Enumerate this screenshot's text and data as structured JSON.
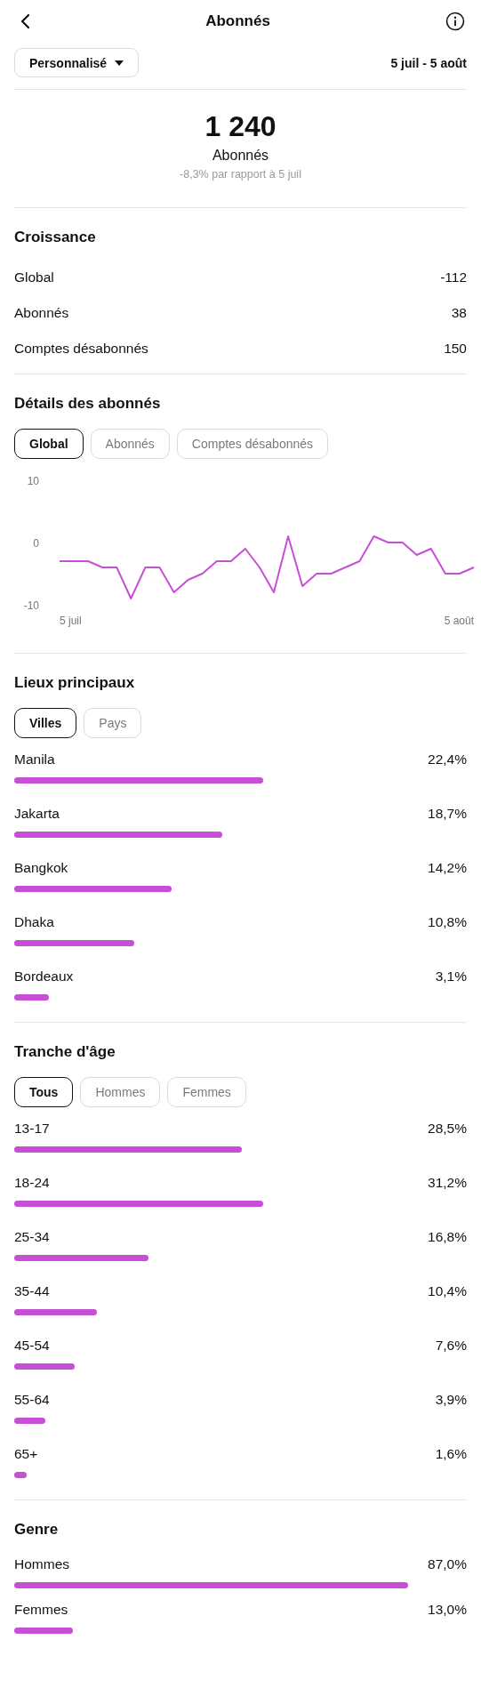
{
  "header": {
    "title": "Abonnés"
  },
  "filter": {
    "label": "Personnalisé",
    "date_range": "5 juil - 5 août"
  },
  "summary": {
    "value": "1 240",
    "label": "Abonnés",
    "comparison": "-8,3% par rapport à 5 juil"
  },
  "growth": {
    "title": "Croissance",
    "rows": [
      {
        "label": "Global",
        "value": "-112"
      },
      {
        "label": "Abonnés",
        "value": "38"
      },
      {
        "label": "Comptes désabonnés",
        "value": "150"
      }
    ]
  },
  "details": {
    "title": "Détails des abonnés",
    "tabs": [
      {
        "label": "Global",
        "selected": true
      },
      {
        "label": "Abonnés",
        "selected": false
      },
      {
        "label": "Comptes désabonnés",
        "selected": false
      }
    ],
    "axis_start_label": "5 juil",
    "axis_end_label": "5 août",
    "chart_data": {
      "type": "line",
      "ylim": [
        -10,
        10
      ],
      "yticks": [
        -10,
        0,
        10
      ],
      "series": [
        {
          "color": "#c74fd6",
          "values": [
            -3,
            -3,
            -3,
            -4,
            -4,
            -9,
            -4,
            -4,
            -8,
            -6,
            -5,
            -3,
            -3,
            -1,
            -4,
            -8,
            1,
            -7,
            -5,
            -5,
            -4,
            -3,
            1,
            0,
            0,
            -2,
            -1,
            -5,
            -5,
            -4
          ]
        }
      ]
    }
  },
  "locations": {
    "title": "Lieux principaux",
    "tabs": [
      {
        "label": "Villes",
        "selected": true
      },
      {
        "label": "Pays",
        "selected": false
      }
    ],
    "rows": [
      {
        "label": "Manila",
        "value": "22,4%"
      },
      {
        "label": "Jakarta",
        "value": "18,7%"
      },
      {
        "label": "Bangkok",
        "value": "14,2%"
      },
      {
        "label": "Dhaka",
        "value": "10,8%"
      },
      {
        "label": "Bordeaux",
        "value": "3,1%"
      }
    ]
  },
  "ages": {
    "title": "Tranche d'âge",
    "tabs": [
      {
        "label": "Tous",
        "selected": true
      },
      {
        "label": "Hommes",
        "selected": false
      },
      {
        "label": "Femmes",
        "selected": false
      }
    ],
    "rows": [
      {
        "label": "13-17",
        "value": "28,5%"
      },
      {
        "label": "18-24",
        "value": "31,2%"
      },
      {
        "label": "25-34",
        "value": "16,8%"
      },
      {
        "label": "35-44",
        "value": "10,4%"
      },
      {
        "label": "45-54",
        "value": "7,6%"
      },
      {
        "label": "55-64",
        "value": "3,9%"
      },
      {
        "label": "65+",
        "value": "1,6%"
      }
    ]
  },
  "gender": {
    "title": "Genre",
    "rows": [
      {
        "label": "Hommes",
        "value": "87,0%"
      },
      {
        "label": "Femmes",
        "value": "13,0%"
      }
    ]
  }
}
